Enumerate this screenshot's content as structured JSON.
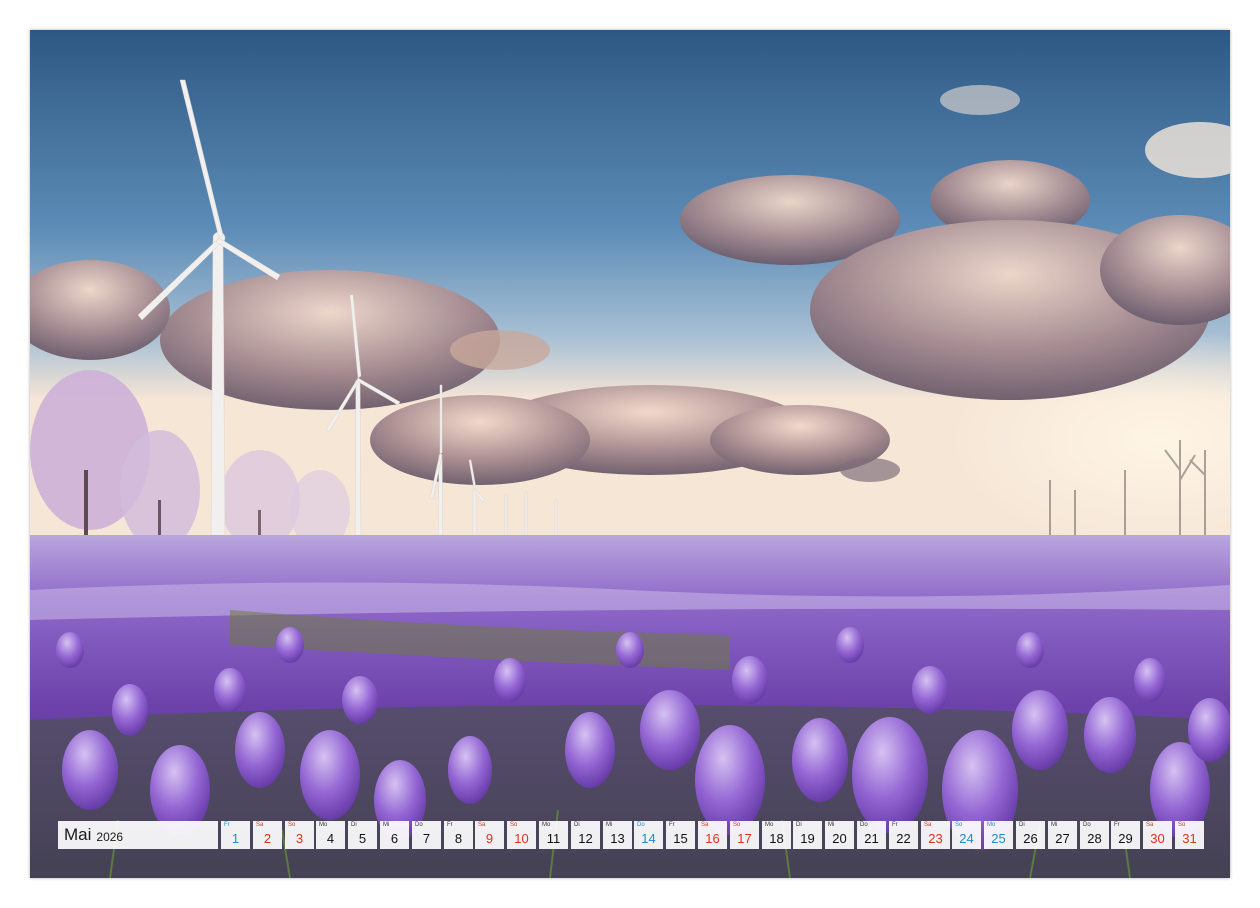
{
  "calendar": {
    "month": "Mai",
    "year": "2026",
    "days": [
      {
        "wd": "Fr",
        "d": "1",
        "kind": "holi"
      },
      {
        "wd": "Sa",
        "d": "2",
        "kind": "sat"
      },
      {
        "wd": "So",
        "d": "3",
        "kind": "sun"
      },
      {
        "wd": "Mo",
        "d": "4",
        "kind": "wk"
      },
      {
        "wd": "Di",
        "d": "5",
        "kind": "wk"
      },
      {
        "wd": "Mi",
        "d": "6",
        "kind": "wk"
      },
      {
        "wd": "Do",
        "d": "7",
        "kind": "wk"
      },
      {
        "wd": "Fr",
        "d": "8",
        "kind": "wk"
      },
      {
        "wd": "Sa",
        "d": "9",
        "kind": "sat"
      },
      {
        "wd": "So",
        "d": "10",
        "kind": "sun"
      },
      {
        "wd": "Mo",
        "d": "11",
        "kind": "wk"
      },
      {
        "wd": "Di",
        "d": "12",
        "kind": "wk"
      },
      {
        "wd": "Mi",
        "d": "13",
        "kind": "wk"
      },
      {
        "wd": "Do",
        "d": "14",
        "kind": "holi"
      },
      {
        "wd": "Fr",
        "d": "15",
        "kind": "wk"
      },
      {
        "wd": "Sa",
        "d": "16",
        "kind": "sat"
      },
      {
        "wd": "So",
        "d": "17",
        "kind": "sun"
      },
      {
        "wd": "Mo",
        "d": "18",
        "kind": "wk"
      },
      {
        "wd": "Di",
        "d": "19",
        "kind": "wk"
      },
      {
        "wd": "Mi",
        "d": "20",
        "kind": "wk"
      },
      {
        "wd": "Do",
        "d": "21",
        "kind": "wk"
      },
      {
        "wd": "Fr",
        "d": "22",
        "kind": "wk"
      },
      {
        "wd": "Sa",
        "d": "23",
        "kind": "sat"
      },
      {
        "wd": "So",
        "d": "24",
        "kind": "holi"
      },
      {
        "wd": "Mo",
        "d": "25",
        "kind": "holi"
      },
      {
        "wd": "Di",
        "d": "26",
        "kind": "wk"
      },
      {
        "wd": "Mi",
        "d": "27",
        "kind": "wk"
      },
      {
        "wd": "Do",
        "d": "28",
        "kind": "wk"
      },
      {
        "wd": "Fr",
        "d": "29",
        "kind": "wk"
      },
      {
        "wd": "Sa",
        "d": "30",
        "kind": "sat"
      },
      {
        "wd": "So",
        "d": "31",
        "kind": "sun"
      }
    ]
  },
  "colors": {
    "sky_top": "#2f5a86",
    "sky_mid": "#6a98c0",
    "horizon_glow": "#fbe9d4",
    "cloud_dark": "#6d5f6d",
    "cloud_light": "#e9cdbf",
    "crocus_purple": "#7c4fc0",
    "crocus_light": "#b896e6",
    "field_green": "#4d6b2e",
    "saturday_sunday": "#d9331f",
    "holiday": "#1a8fc9"
  }
}
